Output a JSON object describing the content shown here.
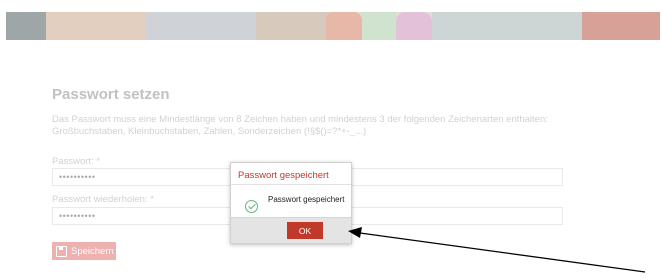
{
  "header": {
    "banner_description": "decorative colorful banner"
  },
  "page": {
    "title": "Passwort setzen",
    "description": "Das Passwort muss eine Mindestlänge von 8 Zeichen haben und mindestens 3 der folgenden Zeichenarten enthalten: Großbuchstaben, Kleinbuchstaben, Zahlen, Sonderzeichen (!§$()=?*+-_...)",
    "password_label": "Passwort: *",
    "password_value": "••••••••••",
    "repeat_label": "Passwort wiederholen: *",
    "repeat_value": "••••••••••",
    "save_label": "Speichern"
  },
  "modal": {
    "title": "Passwort gespeichert",
    "message": "Passwort gespeichert",
    "ok_label": "OK",
    "icon": "check-circle-icon"
  },
  "colors": {
    "accent": "#c0392b",
    "success": "#5fb87a"
  }
}
